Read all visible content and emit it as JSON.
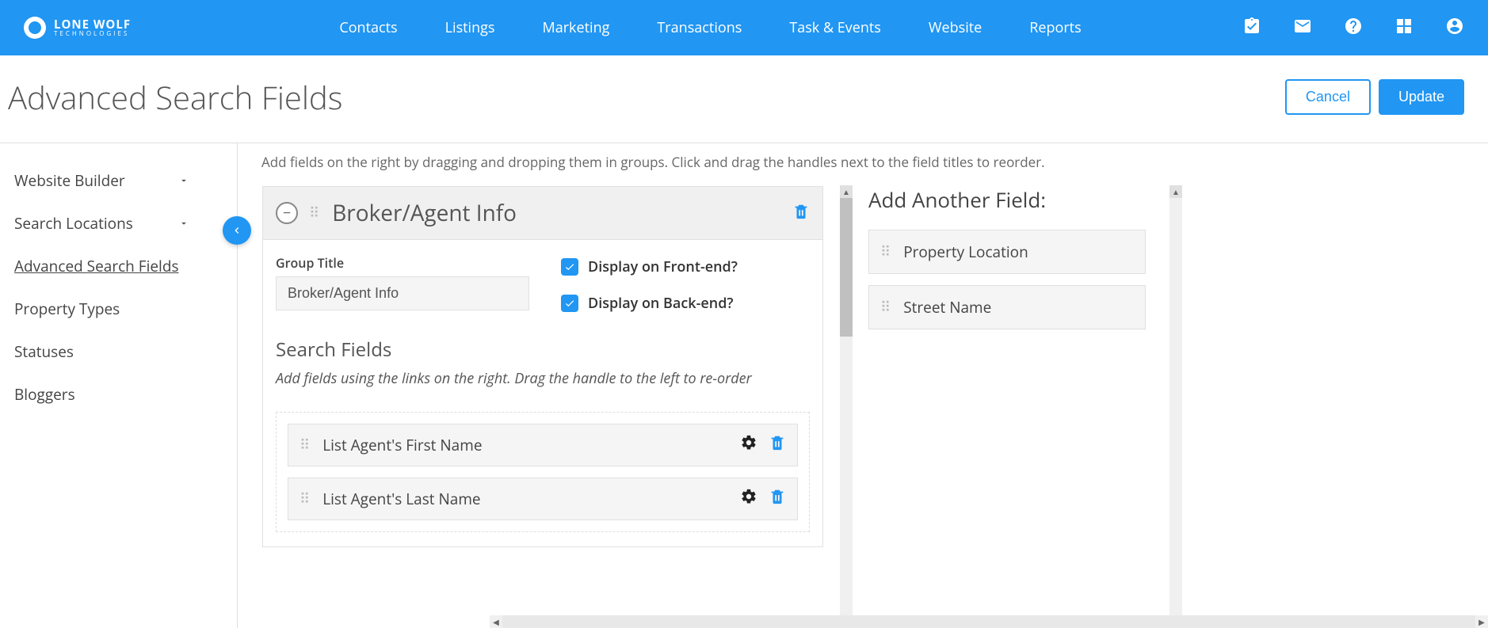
{
  "brand": {
    "name": "LONE WOLF",
    "sub": "TECHNOLOGIES"
  },
  "nav": {
    "items": [
      "Contacts",
      "Listings",
      "Marketing",
      "Transactions",
      "Task & Events",
      "Website",
      "Reports"
    ]
  },
  "page": {
    "title": "Advanced Search Fields",
    "cancel": "Cancel",
    "update": "Update"
  },
  "sidebar": {
    "items": [
      {
        "label": "Website Builder",
        "expandable": true
      },
      {
        "label": "Search Locations",
        "expandable": true
      },
      {
        "label": "Advanced Search Fields",
        "expandable": false,
        "active": true
      },
      {
        "label": "Property Types",
        "expandable": false
      },
      {
        "label": "Statuses",
        "expandable": false
      },
      {
        "label": "Bloggers",
        "expandable": false
      }
    ]
  },
  "helper": "Add fields on the right by dragging and dropping them in groups. Click and drag the handles next to the field titles to reorder.",
  "group": {
    "heading": "Broker/Agent Info",
    "title_label": "Group Title",
    "title_value": "Broker/Agent Info",
    "display_front": "Display on Front-end?",
    "display_back": "Display on Back-end?",
    "search_fields_title": "Search Fields",
    "search_fields_help": "Add fields using the links on the right. Drag the handle to the left to re-order",
    "fields": [
      "List Agent's First Name",
      "List Agent's Last Name"
    ]
  },
  "right": {
    "title": "Add Another Field:",
    "available": [
      "Property Location",
      "Street Name"
    ]
  }
}
